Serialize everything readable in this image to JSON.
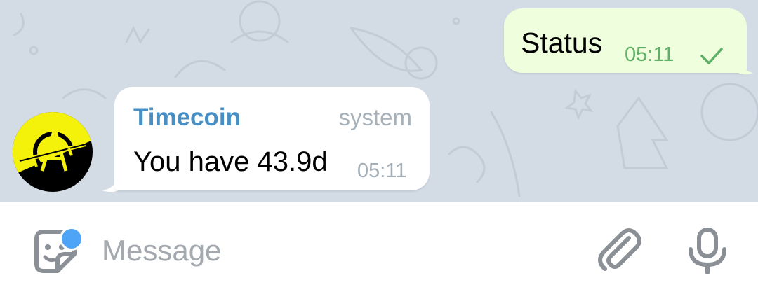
{
  "chat": {
    "outgoing": {
      "text": "Status",
      "time": "05:11",
      "status_icon": "single-check-icon"
    },
    "incoming": {
      "sender": "Timecoin",
      "role": "system",
      "text": "You have 43.9d",
      "time": "05:11",
      "avatar_icon": "anarchist-emblem-avatar"
    }
  },
  "composer": {
    "placeholder": "Message",
    "value": "",
    "icons": [
      "sticker-icon",
      "attach-icon",
      "microphone-icon"
    ]
  },
  "colors": {
    "chat_background": "#d3dce5",
    "outgoing_bubble": "#effedd",
    "outgoing_time": "#5fb167",
    "sender_name": "#4a8fc4",
    "notification_dot": "#4ea4f6",
    "avatar_yellow": "#f4f20a"
  }
}
